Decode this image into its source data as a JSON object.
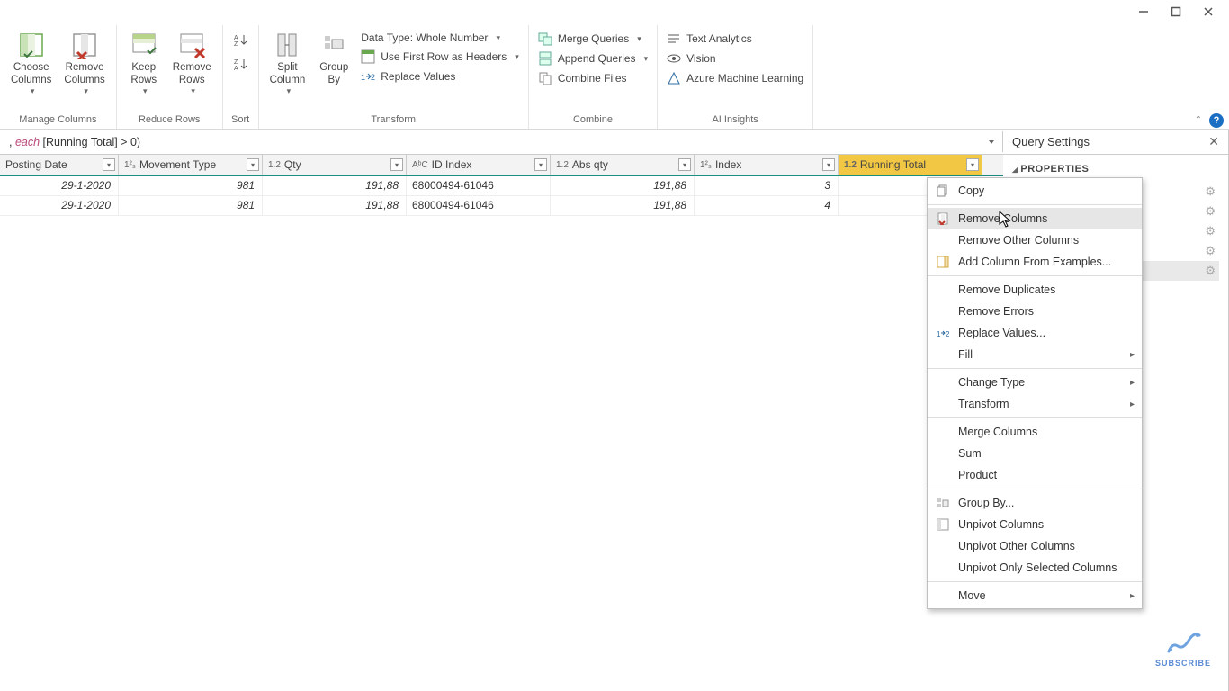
{
  "ribbon": {
    "choose_columns": "Choose\nColumns",
    "remove_columns": "Remove\nColumns",
    "keep_rows": "Keep\nRows",
    "remove_rows": "Remove\nRows",
    "split_column": "Split\nColumn",
    "group_by": "Group\nBy",
    "data_type": "Data Type: Whole Number",
    "use_first_row": "Use First Row as Headers",
    "replace_values": "Replace Values",
    "merge_queries": "Merge Queries",
    "append_queries": "Append Queries",
    "combine_files": "Combine Files",
    "text_analytics": "Text Analytics",
    "vision": "Vision",
    "azure_ml": "Azure Machine Learning",
    "grp_manage_columns": "Manage Columns",
    "grp_reduce_rows": "Reduce Rows",
    "grp_sort": "Sort",
    "grp_transform": "Transform",
    "grp_combine": "Combine",
    "grp_ai": "AI Insights"
  },
  "formula": {
    "prefix": ", ",
    "each": "each",
    "rest": " [Running Total] > 0)"
  },
  "columns": {
    "posting_date": "Posting Date",
    "movement_type": "Movement Type",
    "qty": "Qty",
    "id_index": "ID Index",
    "abs_qty": "Abs qty",
    "index": "Index",
    "running_total": "Running Total"
  },
  "type_badges": {
    "int": "1²₃",
    "dec": "1.2",
    "abc": "AᵇC"
  },
  "rows": [
    {
      "posting_date": "29-1-2020",
      "movement_type": "981",
      "qty": "191,88",
      "id_index": "68000494-61046",
      "abs_qty": "191,88",
      "index": "3"
    },
    {
      "posting_date": "29-1-2020",
      "movement_type": "981",
      "qty": "191,88",
      "id_index": "68000494-61046",
      "abs_qty": "191,88",
      "index": "4"
    }
  ],
  "query_settings": {
    "title": "Query Settings",
    "properties": "PROPERTIES"
  },
  "context_menu": {
    "copy": "Copy",
    "remove_columns": "Remove Columns",
    "remove_other": "Remove Other Columns",
    "add_from_examples": "Add Column From Examples...",
    "remove_duplicates": "Remove Duplicates",
    "remove_errors": "Remove Errors",
    "replace_values": "Replace Values...",
    "fill": "Fill",
    "change_type": "Change Type",
    "transform": "Transform",
    "merge_columns": "Merge Columns",
    "sum": "Sum",
    "product": "Product",
    "group_by": "Group By...",
    "unpivot": "Unpivot Columns",
    "unpivot_other": "Unpivot Other Columns",
    "unpivot_only": "Unpivot Only Selected Columns",
    "move": "Move"
  },
  "subscribe": "SUBSCRIBE"
}
